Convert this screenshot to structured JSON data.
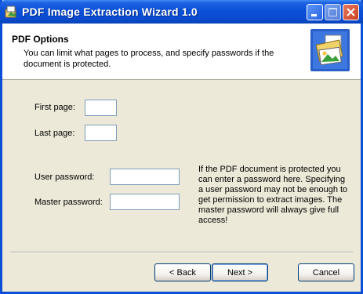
{
  "window": {
    "title": "PDF Image Extraction Wizard 1.0",
    "colors": {
      "titlebar": "#0a50d8",
      "face": "#ece9d8",
      "close": "#c94223"
    }
  },
  "titlebar_buttons": {
    "minimize_icon": "minimize-icon",
    "maximize_icon": "maximize-icon",
    "close_icon": "close-icon"
  },
  "header": {
    "title": "PDF Options",
    "subtitle": "You can limit what pages to process, and specify passwords if the document is protected."
  },
  "form": {
    "first_page": {
      "label": "First page:",
      "value": ""
    },
    "last_page": {
      "label": "Last page:",
      "value": ""
    },
    "user_password": {
      "label": "User password:",
      "value": ""
    },
    "master_password": {
      "label": "Master password:",
      "value": ""
    },
    "help": "If the PDF document is protected you can enter a password here. Specifying a user password may not be enough to get permission to extract images. The master password will always give full access!"
  },
  "buttons": {
    "back": "< Back",
    "next": "Next >",
    "cancel": "Cancel"
  }
}
